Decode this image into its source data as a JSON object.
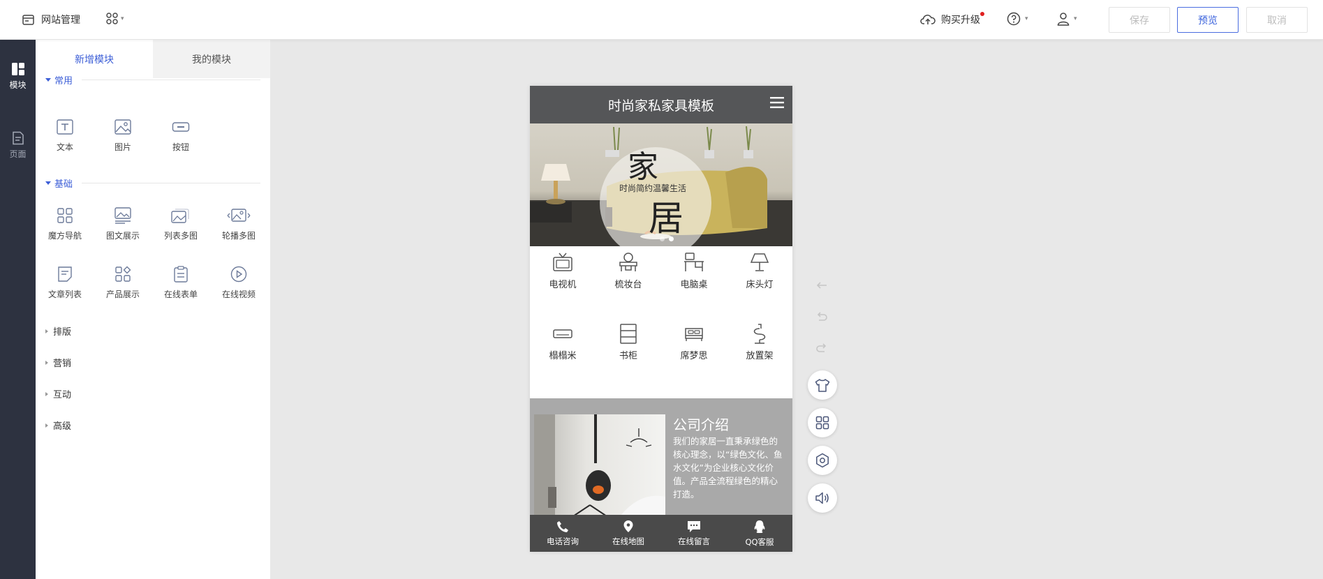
{
  "topbar": {
    "site_label": "网站管理",
    "upgrade_label": "购买升级",
    "save_label": "保存",
    "preview_label": "预览",
    "cancel_label": "取消"
  },
  "rail": {
    "items": [
      {
        "label": "模块",
        "active": true
      },
      {
        "label": "页面",
        "active": false
      }
    ]
  },
  "panel": {
    "tabs": [
      {
        "label": "新增模块",
        "active": true
      },
      {
        "label": "我的模块",
        "active": false
      }
    ],
    "sections": {
      "common": {
        "title": "常用",
        "items": [
          "文本",
          "图片",
          "按钮"
        ]
      },
      "basic": {
        "title": "基础",
        "items": [
          "魔方导航",
          "图文展示",
          "列表多图",
          "轮播多图",
          "文章列表",
          "产品展示",
          "在线表单",
          "在线视频"
        ]
      },
      "collapsed": [
        "排版",
        "营销",
        "互动",
        "高级"
      ]
    }
  },
  "phone": {
    "title": "时尚家私家具模板",
    "banner": {
      "char1": "家",
      "subtitle": "时尚简约温馨生活",
      "char2": "居"
    },
    "categories": [
      "电视机",
      "梳妆台",
      "电脑桌",
      "床头灯",
      "榻榻米",
      "书柜",
      "席梦思",
      "放置架"
    ],
    "intro": {
      "title": "公司介绍",
      "text": "我们的家居一直秉承绿色的核心理念，以“绿色文化、鱼水文化”为企业核心文化价值。产品全流程绿色的精心打造。"
    },
    "footer": [
      "电话咨询",
      "在线地图",
      "在线留言",
      "QQ客服"
    ]
  },
  "colors": {
    "accent": "#3d5fd7",
    "rail_bg": "#2d3240",
    "phone_header": "#555658",
    "intro_bg": "#a9a9a9",
    "footer_bg": "#4a4a4a",
    "badge": "#e02020"
  },
  "icons": {
    "rail": [
      "module-icon",
      "page-icon"
    ],
    "float_tools": [
      "back-arrow-icon",
      "undo-icon",
      "redo-icon",
      "theme-shirt-icon",
      "grid-icon",
      "settings-icon",
      "speaker-icon"
    ]
  }
}
